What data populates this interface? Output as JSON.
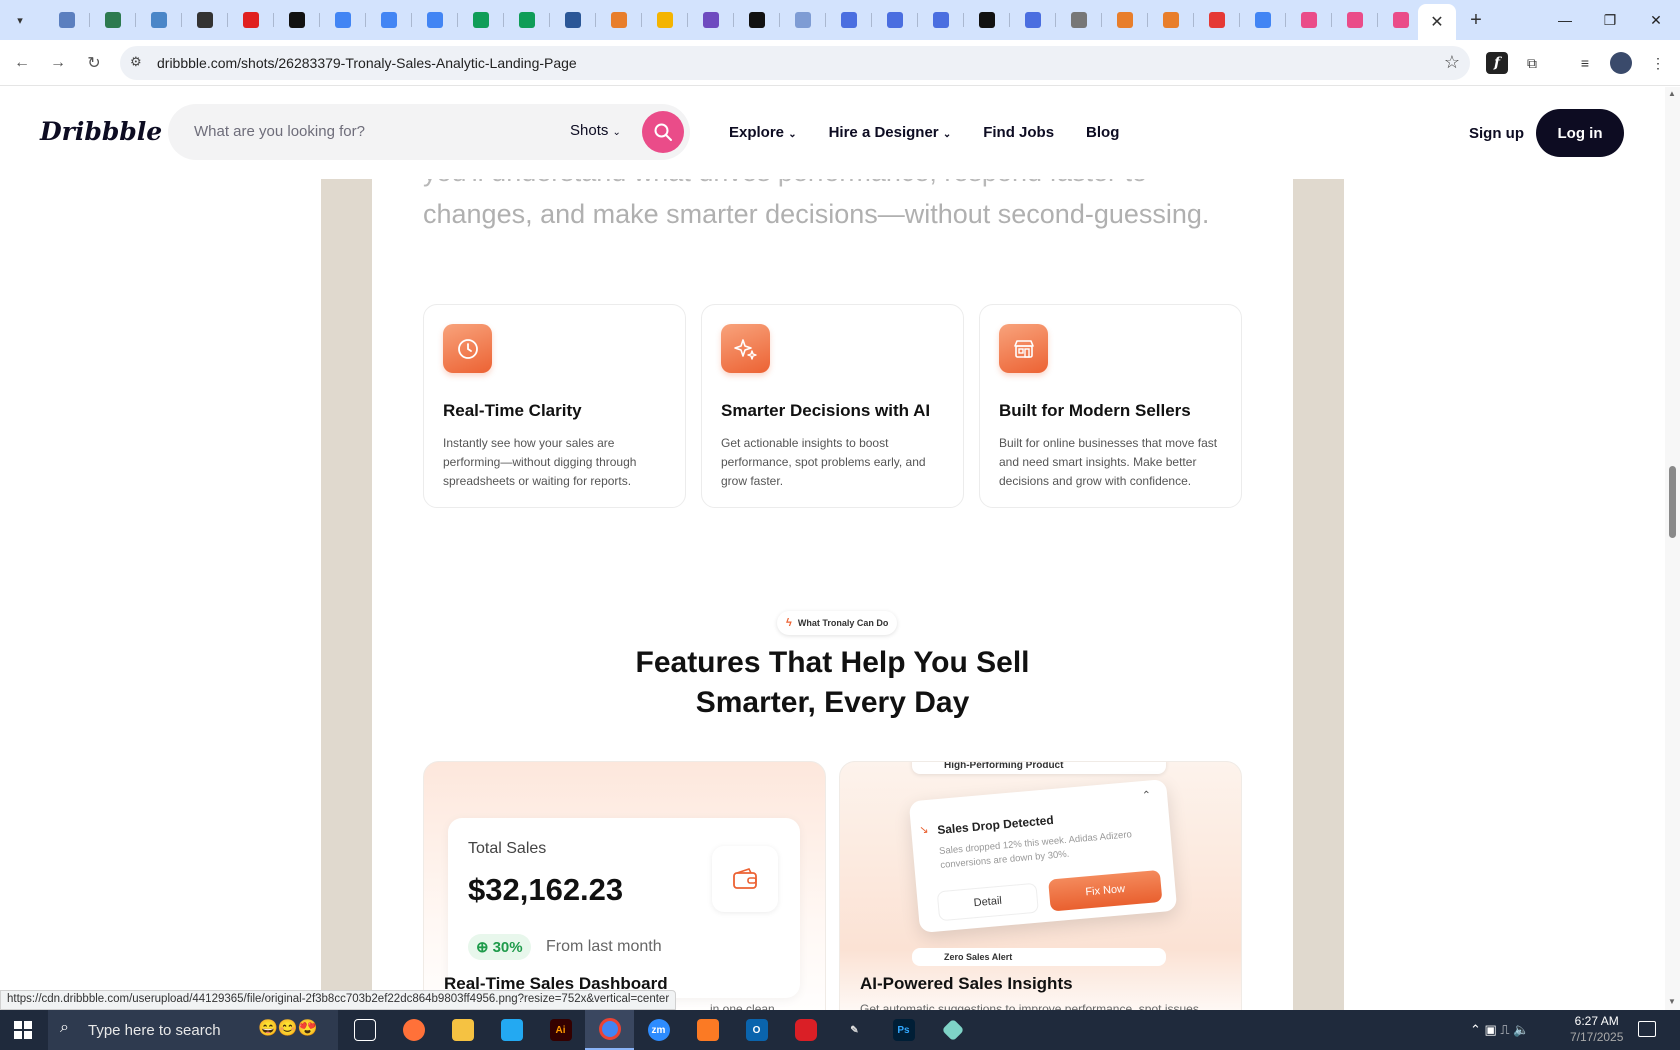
{
  "browser": {
    "url": "dribbble.com/shots/26283379-Tronaly-Sales-Analytic-Landing-Page",
    "tab_colors": [
      "#5b7fbf",
      "#2d7a4f",
      "#4a86c8",
      "#333333",
      "#e02020",
      "#111111",
      "#4285f4",
      "#4285f4",
      "#4285f4",
      "#0f9d58",
      "#0f9d58",
      "#2b5797",
      "#e87e2b",
      "#f4b400",
      "#6e4bbf",
      "#111111",
      "#7e9cd4",
      "#4a6ee0",
      "#4a6ee0",
      "#4a6ee0",
      "#111111",
      "#4a6ee0",
      "#777777",
      "#e87e2b",
      "#e87e2b",
      "#e53935",
      "#4285f4",
      "#ea4c89",
      "#ea4c89",
      "#ea4c89"
    ],
    "status_url": "https://cdn.dribbble.com/userupload/44129365/file/original-2f3b8cc703b2ef22dc864b9803ff4956.png?resize=752x&vertical=center"
  },
  "header": {
    "logo": "Dribbble",
    "search_placeholder": "What are you looking for?",
    "search_scope": "Shots",
    "nav": [
      "Explore",
      "Hire a Designer",
      "Find Jobs",
      "Blog"
    ],
    "signup": "Sign up",
    "login": "Log in",
    "accent": "#ea4c89"
  },
  "shot": {
    "partial_line": "you'll understand what drives performance, respond faster to",
    "lead_line": "changes, and make smarter decisions—without second-guessing.",
    "cards": [
      {
        "icon": "clock-icon",
        "title": "Real-Time Clarity",
        "desc": "Instantly see how your sales are performing—without digging through spreadsheets or waiting for reports."
      },
      {
        "icon": "sparkle-icon",
        "title": "Smarter Decisions with AI",
        "desc": "Get actionable insights to boost performance, spot problems early, and grow faster."
      },
      {
        "icon": "store-icon",
        "title": "Built for Modern Sellers",
        "desc": "Built for online businesses that move fast and need smart insights. Make better decisions and grow with confidence."
      }
    ],
    "pill": "What Tronaly Can Do",
    "features_title_1": "Features That Help You Sell",
    "features_title_2": "Smarter, Every Day",
    "total_sales": {
      "label": "Total Sales",
      "value": "$32,162.23",
      "change": "30%",
      "from": "From last month"
    },
    "left_feature_title": "Real-Time Sales Dashboard",
    "left_feature_desc": "in one clean",
    "alert": {
      "top": "High-Performing Product",
      "title": "Sales Drop Detected",
      "body": "Sales dropped 12% this week. Adidas Adizero conversions are down by 30%.",
      "detail": "Detail",
      "fix": "Fix Now",
      "bottom": "Zero Sales Alert"
    },
    "right_feature_title": "AI-Powered Sales Insights",
    "right_feature_desc": "Get automatic suggestions to improve performance, spot issues"
  },
  "taskbar": {
    "search": "Type here to search",
    "time": "6:27 AM",
    "date": "7/17/2025"
  }
}
